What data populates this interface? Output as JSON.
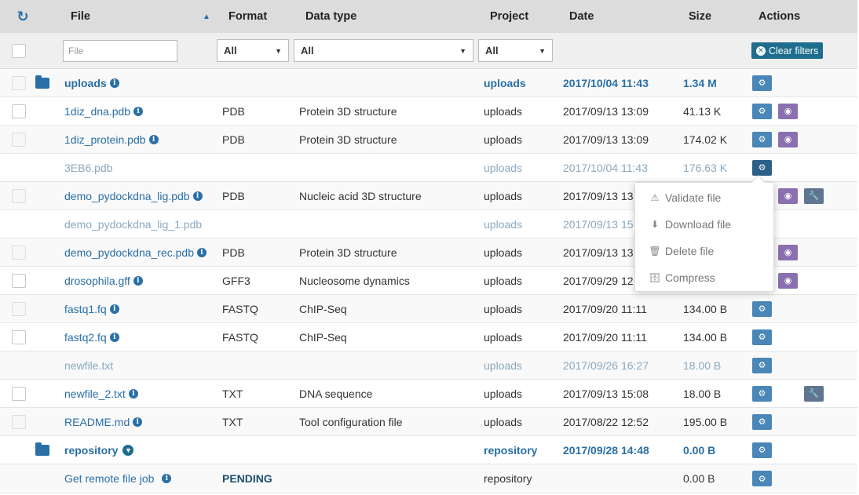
{
  "header": {
    "file": "File",
    "format": "Format",
    "data_type": "Data type",
    "project": "Project",
    "date": "Date",
    "size": "Size",
    "actions": "Actions"
  },
  "filters": {
    "file_placeholder": "File",
    "format_value": "All",
    "data_type_value": "All",
    "project_value": "All",
    "clear_label": "Clear filters"
  },
  "rows": [
    {
      "file": "uploads",
      "format": "",
      "data_type": "",
      "project": "uploads",
      "date": "2017/10/04 11:43",
      "size": "1.34 M"
    },
    {
      "file": "1diz_dna.pdb",
      "format": "PDB",
      "data_type": "Protein 3D structure",
      "project": "uploads",
      "date": "2017/09/13 13:09",
      "size": "41.13 K"
    },
    {
      "file": "1diz_protein.pdb",
      "format": "PDB",
      "data_type": "Protein 3D structure",
      "project": "uploads",
      "date": "2017/09/13 13:09",
      "size": "174.02 K"
    },
    {
      "file": "3EB6.pdb",
      "format": "",
      "data_type": "",
      "project": "uploads",
      "date": "2017/10/04 11:43",
      "size": "176.63 K"
    },
    {
      "file": "demo_pydockdna_lig.pdb",
      "format": "PDB",
      "data_type": "Nucleic acid 3D structure",
      "project": "uploads",
      "date": "2017/09/13 13",
      "size": ""
    },
    {
      "file": "demo_pydockdna_lig_1.pdb",
      "format": "",
      "data_type": "",
      "project": "uploads",
      "date": "2017/09/13 15",
      "size": ""
    },
    {
      "file": "demo_pydockdna_rec.pdb",
      "format": "PDB",
      "data_type": "Protein 3D structure",
      "project": "uploads",
      "date": "2017/09/13 13",
      "size": ""
    },
    {
      "file": "drosophila.gff",
      "format": "GFF3",
      "data_type": "Nucleosome dynamics",
      "project": "uploads",
      "date": "2017/09/29 12",
      "size": ""
    },
    {
      "file": "fastq1.fq",
      "format": "FASTQ",
      "data_type": "ChIP-Seq",
      "project": "uploads",
      "date": "2017/09/20 11:11",
      "size": "134.00 B"
    },
    {
      "file": "fastq2.fq",
      "format": "FASTQ",
      "data_type": "ChIP-Seq",
      "project": "uploads",
      "date": "2017/09/20 11:11",
      "size": "134.00 B"
    },
    {
      "file": "newfile.txt",
      "format": "",
      "data_type": "",
      "project": "uploads",
      "date": "2017/09/26 16:27",
      "size": "18.00 B"
    },
    {
      "file": "newfile_2.txt",
      "format": "TXT",
      "data_type": "DNA sequence",
      "project": "uploads",
      "date": "2017/09/13 15:08",
      "size": "18.00 B"
    },
    {
      "file": "README.md",
      "format": "TXT",
      "data_type": "Tool configuration file",
      "project": "uploads",
      "date": "2017/08/22 12:52",
      "size": "195.00 B"
    },
    {
      "file": "repository",
      "format": "",
      "data_type": "",
      "project": "repository",
      "date": "2017/09/28 14:48",
      "size": "0.00 B"
    },
    {
      "file": "Get remote file job",
      "format": "PENDING",
      "data_type": "",
      "project": "repository",
      "date": "",
      "size": "0.00 B"
    }
  ],
  "menu": {
    "validate": "Validate file",
    "download": "Download file",
    "delete": "Delete file",
    "compress": "Compress"
  },
  "icons": {
    "refresh": "refresh-icon",
    "sort": "sort-ascending-icon",
    "folder": "folder-icon",
    "info": "info-icon",
    "gear": "gears-icon",
    "eye": "eye-icon",
    "wrench": "wrench-icon",
    "chevron": "chevron-down-icon"
  },
  "colors": {
    "link": "#2a6fa6",
    "header_bg": "#dcdcdc",
    "clear_button": "#1e6d8e",
    "gear_button": "#4a86b7",
    "eye_button": "#8a70b0",
    "wrench_button": "#5f7590"
  }
}
